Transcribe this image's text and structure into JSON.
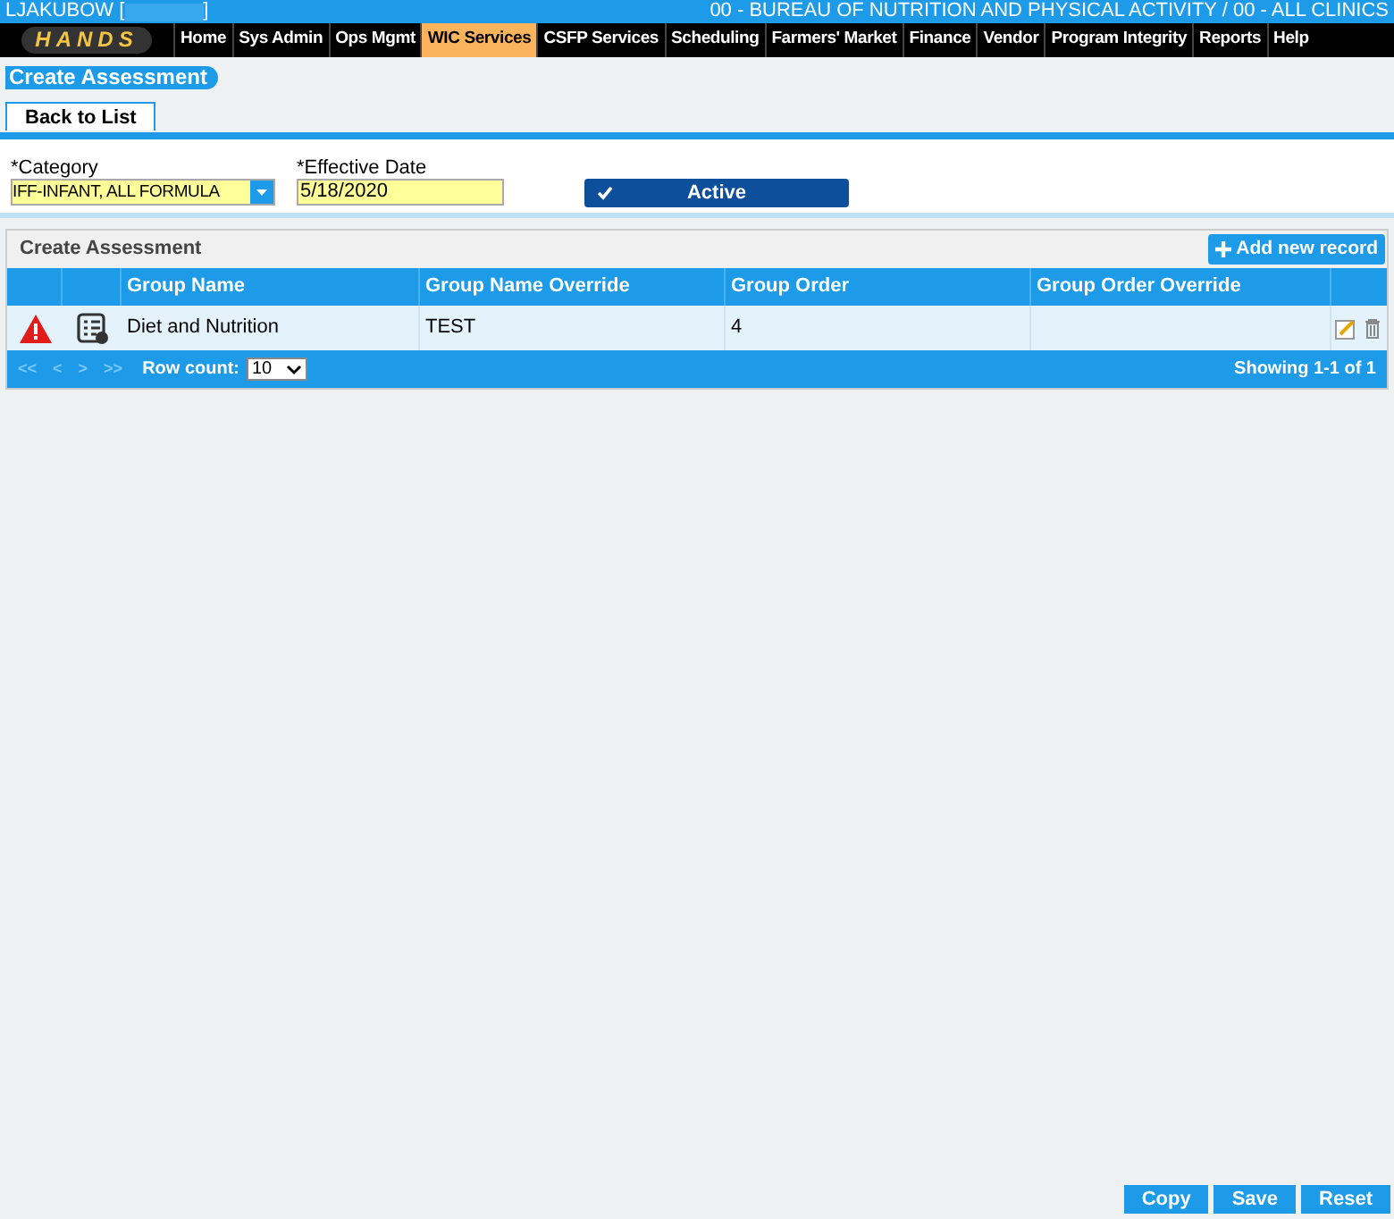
{
  "top_bar": {
    "user": "LJAKUBOW [",
    "user_end": "]",
    "agency": "00 - BUREAU OF NUTRITION AND PHYSICAL ACTIVITY / 00 - ALL CLINICS"
  },
  "logo": "HANDS",
  "nav": [
    {
      "label": "Home",
      "selected": false
    },
    {
      "label": "Sys Admin",
      "selected": false
    },
    {
      "label": "Ops Mgmt",
      "selected": false
    },
    {
      "label": "WIC Services",
      "selected": true
    },
    {
      "label": "CSFP Services",
      "selected": false
    },
    {
      "label": "Scheduling",
      "selected": false
    },
    {
      "label": "Farmers' Market",
      "selected": false
    },
    {
      "label": "Finance",
      "selected": false
    },
    {
      "label": "Vendor",
      "selected": false
    },
    {
      "label": "Program Integrity",
      "selected": false
    },
    {
      "label": "Reports",
      "selected": false
    },
    {
      "label": "Help",
      "selected": false
    }
  ],
  "page_title": "Create Assessment",
  "back_button": "Back to List",
  "form": {
    "category_label": "*Category",
    "category_value": "IFF-INFANT, ALL FORMULA",
    "date_label": "*Effective Date",
    "date_value": "5/18/2020",
    "active_label": "Active",
    "active_checked": true
  },
  "grid": {
    "title": "Create Assessment",
    "add_button": "Add new record",
    "columns": [
      "Group Name",
      "Group Name Override",
      "Group Order",
      "Group Order Override"
    ],
    "rows": [
      {
        "warning": true,
        "cells": [
          "Diet and Nutrition",
          "TEST",
          "4",
          ""
        ]
      }
    ],
    "pager": {
      "first": "<<",
      "prev": "<",
      "next": ">",
      "last": ">>",
      "row_count_label": "Row count:",
      "row_count": "10",
      "showing": "Showing 1-1 of 1"
    }
  },
  "footer_buttons": [
    "Copy",
    "Save",
    "Reset"
  ]
}
